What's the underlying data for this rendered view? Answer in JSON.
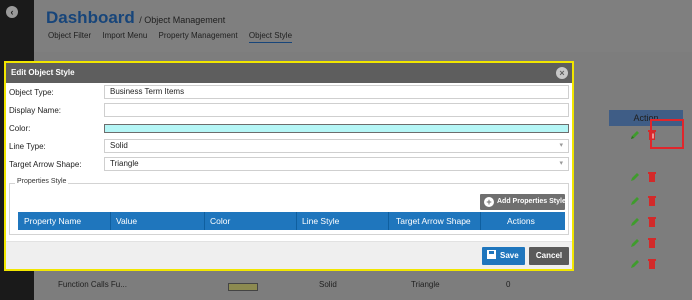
{
  "breadcrumb": {
    "title": "Dashboard",
    "subtitle": "/ Object Management"
  },
  "nav": {
    "items": [
      "Object Filter",
      "Import Menu",
      "Property Management",
      "Object Style"
    ]
  },
  "background_table": {
    "action_header": "Action",
    "last_row": {
      "name": "Function Calls Fu...",
      "line_style": "Solid",
      "arrow_shape": "Triangle",
      "actions": "0"
    }
  },
  "modal": {
    "title": "Edit Object Style",
    "fields": {
      "object_type": {
        "label": "Object Type:",
        "value": "Business Term Items"
      },
      "display_name": {
        "label": "Display Name:",
        "value": ""
      },
      "color": {
        "label": "Color:",
        "value": "#b5f6f6"
      },
      "line_type": {
        "label": "Line Type:",
        "value": "Solid"
      },
      "arrow_shape": {
        "label": "Target Arrow Shape:",
        "value": "Triangle"
      }
    },
    "properties_style": {
      "legend": "Properties Style",
      "add_button": "Add Properties Style",
      "columns": [
        "Property Name",
        "Value",
        "Color",
        "Line Style",
        "Target Arrow Shape",
        "Actions"
      ]
    },
    "footer": {
      "save_label": "Save",
      "cancel_label": "Cancel"
    }
  },
  "colors": {
    "accent": "#1f76bd",
    "brand_title": "#17457a",
    "modal_border": "#f1e600",
    "highlight": "#e0262b",
    "edit_icon": "#3f9c2d",
    "delete_icon": "#d32a2a"
  },
  "icons": [
    "back-icon",
    "pencil-icon",
    "trash-icon",
    "close-icon",
    "plus-icon",
    "floppy-icon"
  ]
}
